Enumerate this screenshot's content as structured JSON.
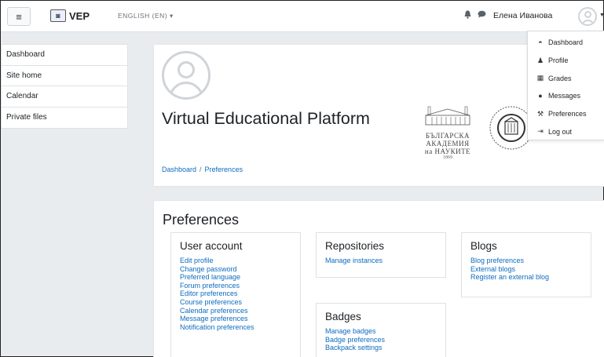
{
  "navbar": {
    "menu_icon": "≡",
    "brand_name": "VEP",
    "language": "ENGLISH (EN) ▾",
    "user_name": "Елена Иванова",
    "icons": [
      "bell-icon",
      "message-icon",
      "avatar",
      "chevron-down-icon"
    ]
  },
  "drawer": {
    "items": [
      "Dashboard",
      "Site home",
      "Calendar",
      "Private files"
    ]
  },
  "header": {
    "site_title": "Virtual Educational Platform",
    "academy_lines": [
      "БЪЛГАРСКА",
      "АКАДЕМИЯ",
      "на НАУКИТЕ"
    ],
    "academy_year": "1869",
    "breadcrumb": [
      "Dashboard",
      "Preferences"
    ]
  },
  "user_menu": {
    "items": [
      {
        "label": "Dashboard",
        "icon": "dashboard-icon"
      },
      {
        "label": "Profile",
        "icon": "user-icon"
      },
      {
        "label": "Grades",
        "icon": "table-icon"
      },
      {
        "label": "Messages",
        "icon": "message-icon"
      },
      {
        "label": "Preferences",
        "icon": "wrench-icon"
      },
      {
        "label": "Log out",
        "icon": "logout-icon"
      }
    ]
  },
  "preferences": {
    "title": "Preferences",
    "user_account": {
      "heading": "User account",
      "links": [
        "Edit profile",
        "Change password",
        "Preferred language",
        "Forum preferences",
        "Editor preferences",
        "Course preferences",
        "Calendar preferences",
        "Message preferences",
        "Notification preferences"
      ]
    },
    "repositories": {
      "heading": "Repositories",
      "links": [
        "Manage instances"
      ]
    },
    "blogs": {
      "heading": "Blogs",
      "links": [
        "Blog preferences",
        "External blogs",
        "Register an external blog"
      ]
    },
    "badges": {
      "heading": "Badges",
      "links": [
        "Manage badges",
        "Badge preferences",
        "Backpack settings"
      ]
    }
  },
  "colors": {
    "link": "#0f6cbf",
    "page_bg": "#e9ecef",
    "text": "#1d2125"
  }
}
